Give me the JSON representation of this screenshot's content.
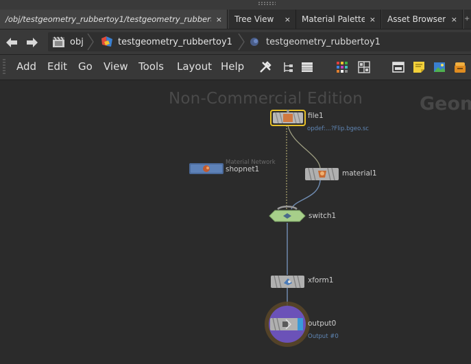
{
  "tabs": [
    {
      "label": "/obj/testgeometry_rubbertoy1/testgeometry_rubbert...",
      "close": "×"
    },
    {
      "label": "Tree View",
      "close": "×"
    },
    {
      "label": "Material Palette",
      "close": "×"
    },
    {
      "label": "Asset Browser",
      "close": "×"
    }
  ],
  "tab_overflow": "+",
  "path": {
    "back_icon": "arrow-left-icon",
    "forward_icon": "arrow-right-icon",
    "crumbs": [
      "obj",
      "testgeometry_rubbertoy1",
      "testgeometry_rubbertoy1"
    ]
  },
  "menu": {
    "items": [
      "Add",
      "Edit",
      "Go",
      "View",
      "Tools",
      "Layout",
      "Help"
    ]
  },
  "network": {
    "watermark": "Non-Commercial Edition",
    "context_label": "Geom",
    "nodes": {
      "file1": {
        "name": "file1",
        "sub": "opdef:...?Flip.bgeo.sc"
      },
      "shopnet1": {
        "name": "shopnet1",
        "sub": "Material Network"
      },
      "material1": {
        "name": "material1"
      },
      "switch1": {
        "name": "switch1"
      },
      "xform1": {
        "name": "xform1"
      },
      "output0": {
        "name": "output0",
        "sub": "Output #0"
      }
    }
  },
  "colors": {
    "background": "#2b2b2b",
    "display_flag": "#e8c22a",
    "switch_node": "#a7cf8a",
    "output_ring": "#6b52b8",
    "output_glow": "#8a6b30",
    "wire": "#6f8bb0"
  }
}
